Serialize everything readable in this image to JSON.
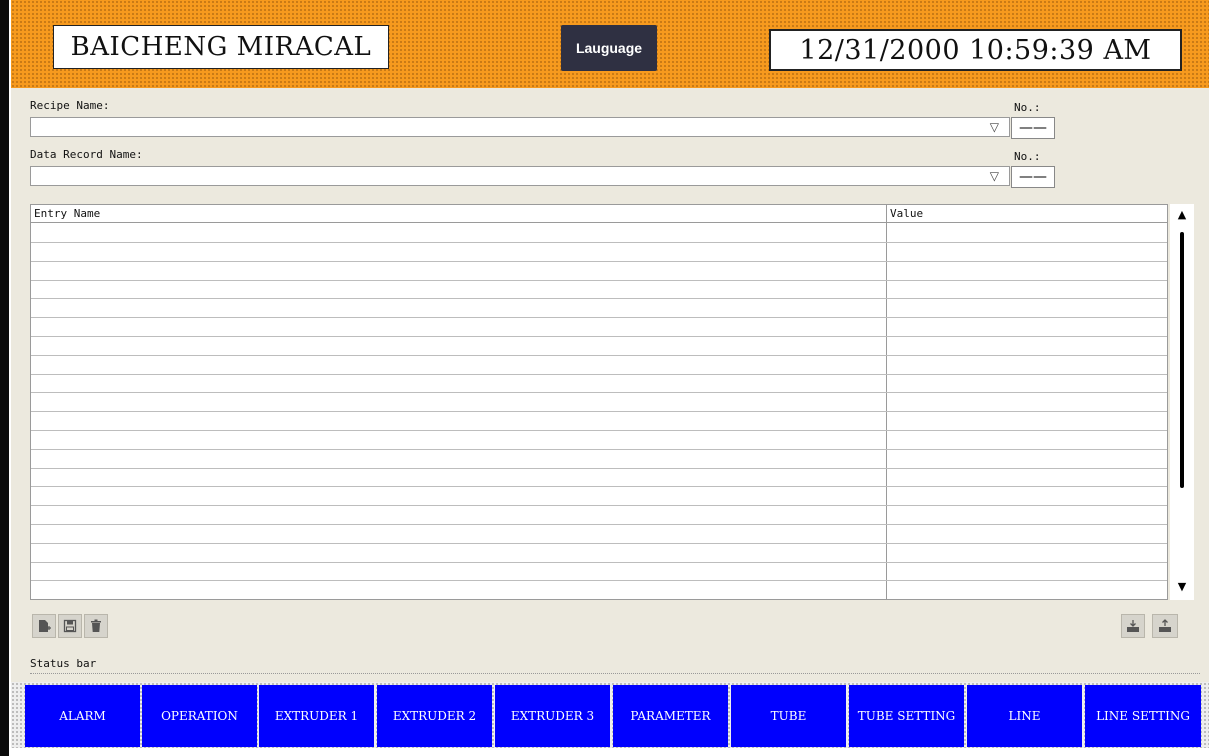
{
  "header": {
    "brand": "BAICHENG MIRACAL",
    "language_button": "Lauguage",
    "datetime": "12/31/2000 10:59:39 AM",
    "background_color": "#f79a1e"
  },
  "recipe": {
    "recipe_name_label": "Recipe Name:",
    "recipe_name_value": "",
    "recipe_no_label": "No.:",
    "recipe_no_value": "——",
    "data_record_label": "Data Record Name:",
    "data_record_value": "",
    "data_record_no_label": "No.:",
    "data_record_no_value": "——",
    "dropdown_icon": "triangle-down-icon"
  },
  "table": {
    "columns": [
      "Entry Name",
      "Value"
    ],
    "rows": []
  },
  "toolbar": {
    "left_icons": [
      "new-record-icon",
      "save-icon",
      "delete-icon"
    ],
    "right_icons": [
      "import-icon",
      "export-icon"
    ]
  },
  "status_bar": {
    "label": "Status bar"
  },
  "nav": {
    "items": [
      {
        "label": "ALARM"
      },
      {
        "label": "OPERATION"
      },
      {
        "label": "EXTRUDER 1"
      },
      {
        "label": "EXTRUDER 2"
      },
      {
        "label": "EXTRUDER 3"
      },
      {
        "label": "PARAMETER"
      },
      {
        "label": "TUBE"
      },
      {
        "label": "TUBE SETTING"
      },
      {
        "label": "LINE"
      },
      {
        "label": "LINE SETTING"
      }
    ],
    "button_color": "#0000fe"
  }
}
